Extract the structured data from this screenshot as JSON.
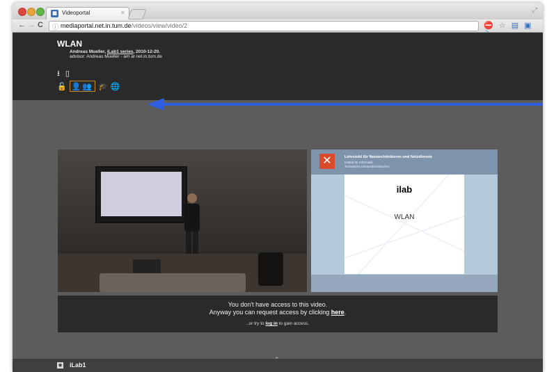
{
  "browser": {
    "tab_title": "Videoportal",
    "tab_close": "×",
    "url_domain": "mediaportal.net.in.tum.de",
    "url_path": "/videos/view/video/2",
    "back": "←",
    "forward": "→",
    "reload": "C"
  },
  "video": {
    "title": "WLAN",
    "author": "Andreas Mueller,",
    "series_link": "iLab1 series",
    "date": ", 2010-12-20.",
    "advisor": "advisor: Andreas Mueller - am at net.in.tum.de"
  },
  "slide": {
    "header1": "Lehrstuhl für Netzarchitekturen und Netzdienste",
    "header2": "Institut für Informatik",
    "header3": "Technische Universität München",
    "heading": "ilab",
    "subtitle": "WLAN"
  },
  "notice": {
    "line1": "You don't have access to this video.",
    "line2_pre": "Anyway you can request access by clicking ",
    "line2_link": "here",
    "line2_post": ".",
    "line3_pre": "..or try to ",
    "line3_link": "log in",
    "line3_post": " to gain access."
  },
  "footer": {
    "label": "iLab1"
  },
  "colors": {
    "arrow": "#2f5fe0",
    "header_bg": "#2a2a2a",
    "page_bg": "#5c5c5c"
  }
}
